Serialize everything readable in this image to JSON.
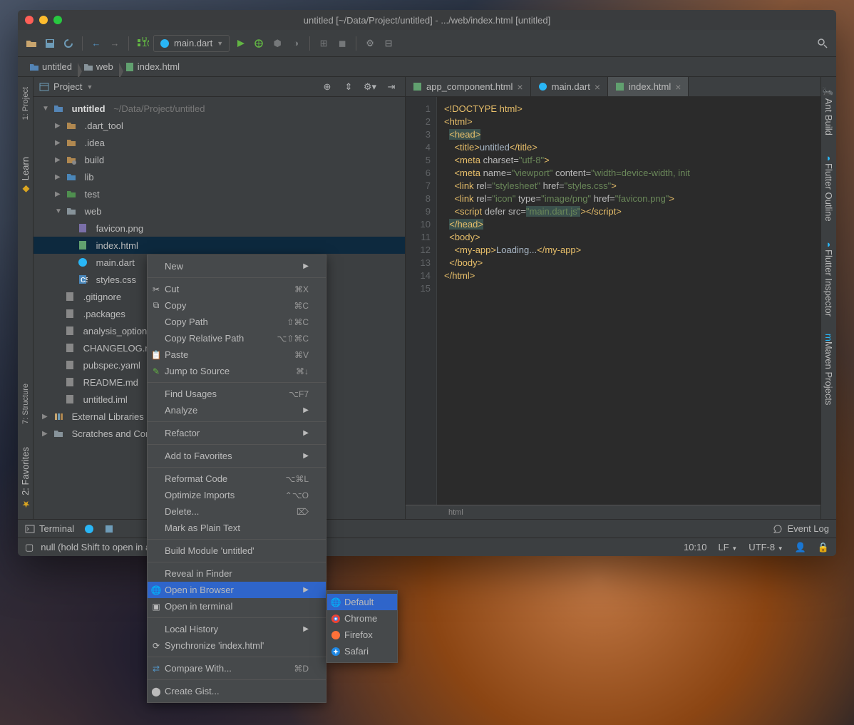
{
  "title": "untitled [~/Data/Project/untitled] - .../web/index.html [untitled]",
  "run_config": "main.dart",
  "breadcrumbs": [
    "untitled",
    "web",
    "index.html"
  ],
  "project_header": "Project",
  "tree": {
    "root": {
      "name": "untitled",
      "path": "~/Data/Project/untitled"
    },
    "items": [
      "​.dart_tool",
      ".idea",
      "build",
      "lib",
      "test",
      "web"
    ],
    "web": [
      "favicon.png",
      "index.html",
      "main.dart",
      "styles.css"
    ],
    "files": [
      ".gitignore",
      ".packages",
      "analysis_options.yaml",
      "CHANGELOG.md",
      "pubspec.yaml",
      "README.md",
      "untitled.iml"
    ],
    "ext": "External Libraries",
    "scratch": "Scratches and Consoles"
  },
  "tabs": [
    {
      "label": "app_component.html"
    },
    {
      "label": "main.dart"
    },
    {
      "label": "index.html",
      "active": true
    }
  ],
  "ctx": {
    "new": "New",
    "cut": "Cut",
    "cut_sc": "⌘X",
    "copy": "Copy",
    "copy_sc": "⌘C",
    "copypath": "Copy Path",
    "copypath_sc": "⇧⌘C",
    "copyrel": "Copy Relative Path",
    "copyrel_sc": "⌥⇧⌘C",
    "paste": "Paste",
    "paste_sc": "⌘V",
    "jump": "Jump to Source",
    "jump_sc": "⌘↓",
    "find": "Find Usages",
    "find_sc": "⌥F7",
    "analyze": "Analyze",
    "refactor": "Refactor",
    "fav": "Add to Favorites",
    "reformat": "Reformat Code",
    "reformat_sc": "⌥⌘L",
    "opt": "Optimize Imports",
    "opt_sc": "⌃⌥O",
    "del": "Delete...",
    "del_sc": "⌦",
    "plain": "Mark as Plain Text",
    "build": "Build Module 'untitled'",
    "reveal": "Reveal in Finder",
    "browser": "Open in Browser",
    "term": "Open in terminal",
    "hist": "Local History",
    "sync": "Synchronize 'index.html'",
    "compare": "Compare With...",
    "compare_sc": "⌘D",
    "gist": "Create Gist..."
  },
  "browsers": {
    "default": "Default",
    "chrome": "Chrome",
    "firefox": "Firefox",
    "safari": "Safari"
  },
  "bottom": {
    "terminal": "Terminal",
    "eventlog": "Event Log"
  },
  "status": {
    "hint": "null (hold Shift to open in a new window)",
    "pos": "10:10",
    "lf": "LF",
    "enc": "UTF-8"
  },
  "left_tabs": [
    "1: Project",
    "Learn",
    "7: Structure",
    "2: Favorites"
  ],
  "right_tabs": [
    "Ant Build",
    "Flutter Outline",
    "Flutter Inspector",
    "Maven Projects"
  ],
  "editor_breadcrumb": "html"
}
